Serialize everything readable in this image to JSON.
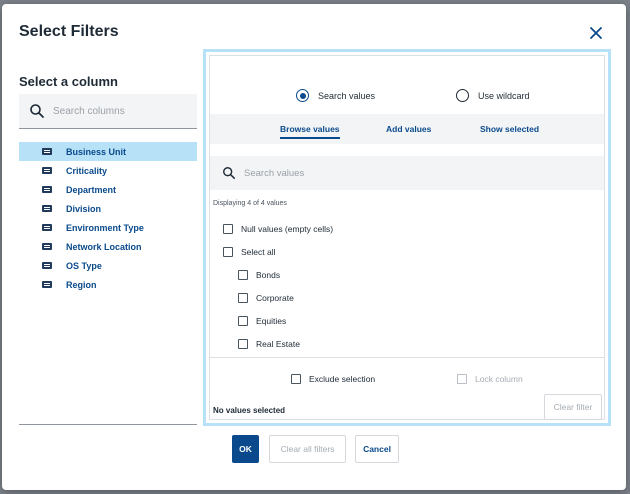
{
  "dialog": {
    "title": "Select Filters"
  },
  "columns": {
    "heading": "Select a column",
    "search_placeholder": "Search columns",
    "items": [
      {
        "label": "Business Unit",
        "selected": true
      },
      {
        "label": "Criticality",
        "selected": false
      },
      {
        "label": "Department",
        "selected": false
      },
      {
        "label": "Division",
        "selected": false
      },
      {
        "label": "Environment Type",
        "selected": false
      },
      {
        "label": "Network Location",
        "selected": false
      },
      {
        "label": "OS Type",
        "selected": false
      },
      {
        "label": "Region",
        "selected": false
      }
    ]
  },
  "filter": {
    "mode": {
      "search_label": "Search values",
      "wildcard_label": "Use wildcard",
      "selected": "search"
    },
    "tabs": {
      "browse": "Browse values",
      "add": "Add values",
      "show": "Show selected",
      "active": "browse"
    },
    "search_placeholder": "Search values",
    "displaying": "Displaying 4 of 4 values",
    "null_values": "Null values (empty cells)",
    "select_all": "Select all",
    "values": [
      "Bonds",
      "Corporate",
      "Equities",
      "Real Estate"
    ],
    "exclude_selection": "Exclude selection",
    "lock_column": "Lock column",
    "status": "No values selected",
    "clear_filter": "Clear filter"
  },
  "footer": {
    "ok": "OK",
    "clear_all": "Clear all filters",
    "cancel": "Cancel"
  },
  "colors": {
    "accent": "#0a4a8c",
    "selected_bg": "#b7e1f7",
    "panel_border": "#b7e1f7"
  }
}
